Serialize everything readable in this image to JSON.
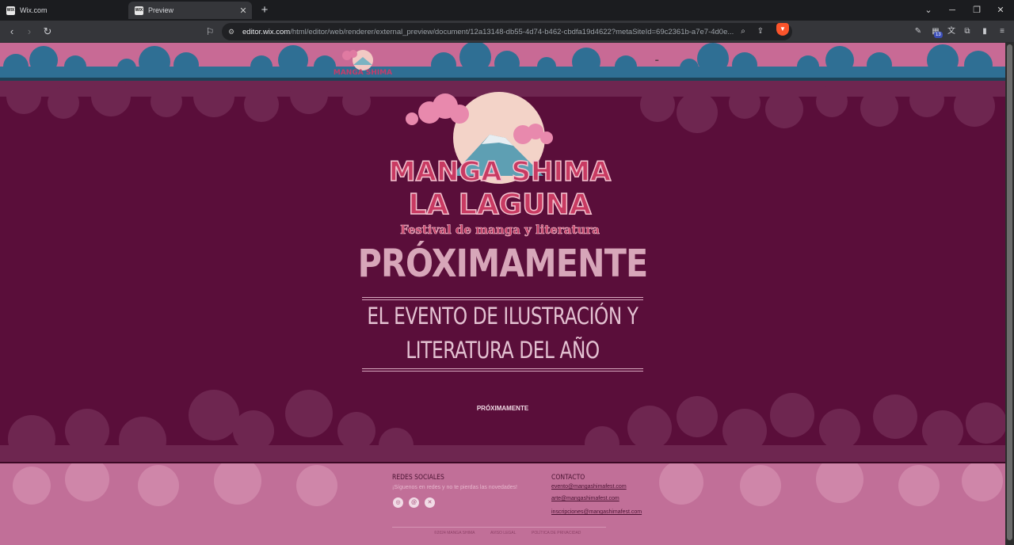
{
  "browser": {
    "tabs": [
      {
        "label": "Wix.com",
        "favicon": "WIX"
      },
      {
        "label": "Preview",
        "favicon": "WIX"
      }
    ],
    "url_domain": "editor.wix.com",
    "url_path": "/html/editor/web/renderer/external_preview/document/12a13148-db55-4d74-b462-cbdfa19d4622?metaSiteId=69c2361b-a7e7-4d0e...",
    "extension_badge": "13"
  },
  "header": {
    "logo_text": "MANGA SHIMA"
  },
  "hero": {
    "logo_line1": "MANGA SHIMA",
    "logo_line2": "LA LAGUNA",
    "logo_tagline": "Festival de manga y literatura",
    "title": "PRÓXIMAMENTE",
    "subtitle_line1": "EL EVENTO DE ILUSTRACIÓN Y",
    "subtitle_line2": "LITERATURA DEL AÑO",
    "small_label": "PRÓXIMAMENTE"
  },
  "footer": {
    "social_heading": "REDES SOCIALES",
    "social_text": "¡Síguenos en redes y no te pierdas las novedades!",
    "social_icons": [
      "instagram-icon",
      "threads-icon",
      "x-icon"
    ],
    "contact_heading": "CONTACTO",
    "emails": [
      "evento@mangashimafest.com",
      "arte@mangashimafest.com",
      "inscripciones@mangashimafest.com"
    ],
    "legal": [
      "©2024 MANGA SHIMA",
      "AVISO LEGAL",
      "POLÍTICA DE PRIVACIDAD"
    ]
  },
  "colors": {
    "page_bg": "#5a0e3a",
    "header_pink": "#c86a95",
    "cloud_blue": "#2f6f94",
    "title_pink": "#d7a6b9",
    "footer_pink": "#c16f98"
  }
}
